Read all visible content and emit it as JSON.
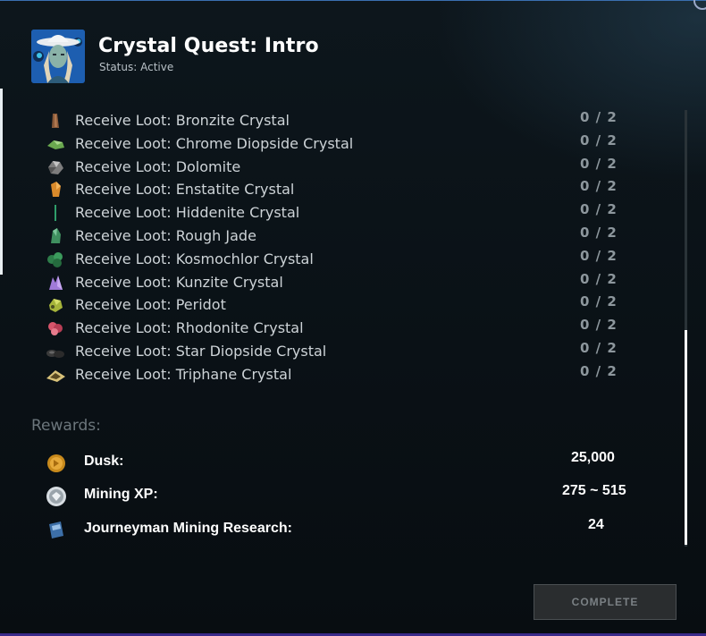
{
  "quest": {
    "title": "Crystal Quest: Intro",
    "status": "Status: Active"
  },
  "objectives": [
    {
      "label": "Receive Loot: Bronzite Crystal",
      "count": "0 / 2",
      "icon": "bronzite-crystal-icon",
      "color": "#8a5a3a"
    },
    {
      "label": "Receive Loot: Chrome Diopside Crystal",
      "count": "0 / 2",
      "icon": "chrome-diopside-crystal-icon",
      "color": "#6aa84f"
    },
    {
      "label": "Receive Loot: Dolomite",
      "count": "0 / 2",
      "icon": "dolomite-icon",
      "color": "#8c8c8c"
    },
    {
      "label": "Receive Loot: Enstatite Crystal",
      "count": "0 / 2",
      "icon": "enstatite-crystal-icon",
      "color": "#d98a2b"
    },
    {
      "label": "Receive Loot: Hiddenite Crystal",
      "count": "0 / 2",
      "icon": "hiddenite-crystal-icon",
      "color": "#2f9e6a"
    },
    {
      "label": "Receive Loot: Rough Jade",
      "count": "0 / 2",
      "icon": "rough-jade-icon",
      "color": "#3f8f5f"
    },
    {
      "label": "Receive Loot: Kosmochlor Crystal",
      "count": "0 / 2",
      "icon": "kosmochlor-crystal-icon",
      "color": "#2e7d4a"
    },
    {
      "label": "Receive Loot: Kunzite Crystal",
      "count": "0 / 2",
      "icon": "kunzite-crystal-icon",
      "color": "#a07ad8"
    },
    {
      "label": "Receive Loot: Peridot",
      "count": "0 / 2",
      "icon": "peridot-icon",
      "color": "#a6b43a"
    },
    {
      "label": "Receive Loot: Rhodonite Crystal",
      "count": "0 / 2",
      "icon": "rhodonite-crystal-icon",
      "color": "#d8556b"
    },
    {
      "label": "Receive Loot: Star Diopside Crystal",
      "count": "0 / 2",
      "icon": "star-diopside-crystal-icon",
      "color": "#3a3a3a"
    },
    {
      "label": "Receive Loot: Triphane Crystal",
      "count": "0 / 2",
      "icon": "triphane-crystal-icon",
      "color": "#d8c27a"
    }
  ],
  "rewards": {
    "title": "Rewards:",
    "items": [
      {
        "label": "Dusk:",
        "value": "25,000",
        "icon": "dusk-coin-icon"
      },
      {
        "label": "Mining XP:",
        "value": "275 ~ 515",
        "icon": "mining-xp-icon"
      },
      {
        "label": "Journeyman Mining Research:",
        "value": "24",
        "icon": "research-scroll-icon"
      }
    ]
  },
  "complete_button": "COMPLETE"
}
